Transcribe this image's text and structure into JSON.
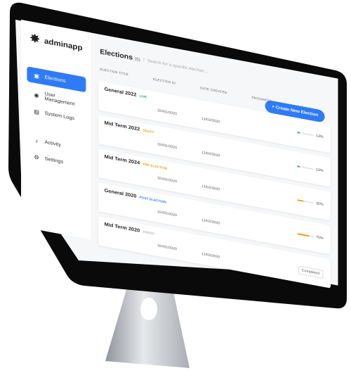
{
  "app": {
    "brand": "adminapp"
  },
  "sidebar": {
    "items": [
      {
        "label": "Elections",
        "icon": "ballot-icon",
        "active": true
      },
      {
        "label": "User Management",
        "icon": "users-icon",
        "active": false
      },
      {
        "label": "System Logs",
        "icon": "logs-icon",
        "active": false
      },
      {
        "label": "Activity",
        "icon": "bell-icon",
        "active": false
      },
      {
        "label": "Settings",
        "icon": "gear-icon",
        "active": false
      }
    ]
  },
  "main": {
    "title": "Elections",
    "count": "(5)",
    "search_placeholder": "Search for a specific election...",
    "create_button": "+ Create New Election",
    "columns": [
      "Election Title",
      "Election ID",
      "Date Created",
      "Progress"
    ],
    "rows": [
      {
        "name": "General 2022",
        "status": "LIVE",
        "status_class": "live",
        "id": "32431/2020",
        "date": "11/02/2020",
        "progress": "13%",
        "progress_value": 13,
        "color": "#2aa866"
      },
      {
        "name": "Mid Term 2022",
        "status": "DRAFT",
        "status_class": "draft",
        "id": "32431/2020",
        "date": "11/02/2020",
        "progress": "13%",
        "progress_value": 13,
        "color": "#2aa866"
      },
      {
        "name": "Mid Term 2024",
        "status": "PRE ELECTION",
        "status_class": "pre",
        "id": "32431/2020",
        "date": "11/02/2020",
        "progress": "35%",
        "progress_value": 35,
        "color": "#e8a317"
      },
      {
        "name": "General 2020",
        "status": "POST ELECTION",
        "status_class": "post",
        "id": "32431/2020",
        "date": "11/02/2020",
        "progress": "75%",
        "progress_value": 75,
        "color": "#e8a317"
      },
      {
        "name": "Mid Term 2020",
        "status": "ENDED",
        "status_class": "ended",
        "id": "32431/2020",
        "date": "11/02/2020",
        "progress": "13%",
        "progress_value": 13,
        "color": "#2f7bf6"
      }
    ],
    "completed_label": "Completed"
  },
  "colors": {
    "accent": "#2f7bf6",
    "bezel": "#0b0b0b",
    "stand": "#c9ccd1"
  }
}
